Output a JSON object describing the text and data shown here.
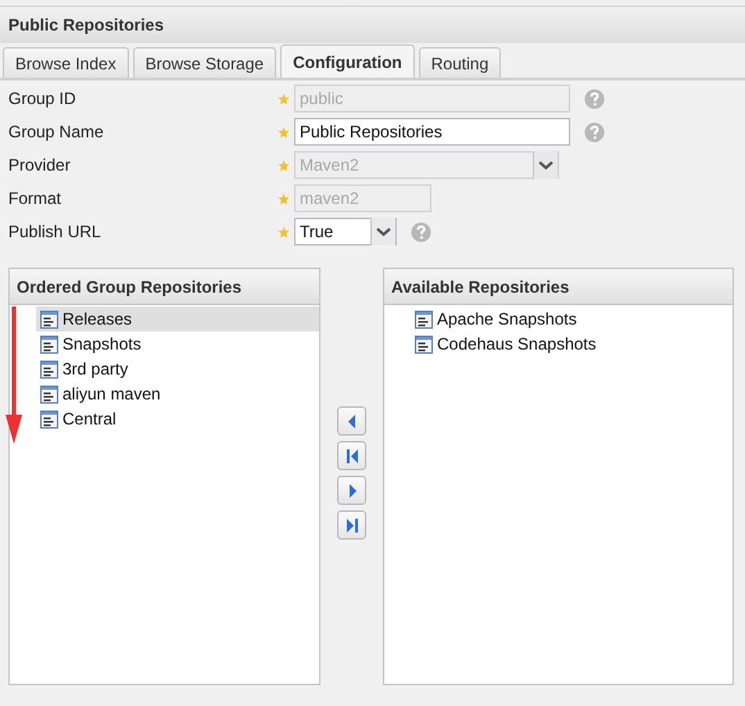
{
  "window": {
    "title": "Public Repositories"
  },
  "tabs": [
    {
      "label": "Browse Index",
      "selected": false
    },
    {
      "label": "Browse Storage",
      "selected": false
    },
    {
      "label": "Configuration",
      "selected": true
    },
    {
      "label": "Routing",
      "selected": false
    }
  ],
  "fields": [
    {
      "label": "Group ID",
      "kind": "text",
      "value": "public",
      "disabled": true,
      "required": true,
      "help": true
    },
    {
      "label": "Group Name",
      "kind": "text",
      "value": "Public Repositories",
      "disabled": false,
      "required": true,
      "help": true
    },
    {
      "label": "Provider",
      "kind": "select",
      "value": "Maven2",
      "disabled": true,
      "required": true,
      "help": false
    },
    {
      "label": "Format",
      "kind": "text",
      "value": "maven2",
      "disabled": true,
      "required": true,
      "help": false
    },
    {
      "label": "Publish URL",
      "kind": "select",
      "value": "True",
      "disabled": false,
      "required": true,
      "help": true
    }
  ],
  "ordered_panel": {
    "title": "Ordered Group Repositories",
    "items": [
      {
        "name": "Releases",
        "selected": true
      },
      {
        "name": "Snapshots",
        "selected": false
      },
      {
        "name": "3rd party",
        "selected": false
      },
      {
        "name": "aliyun maven",
        "selected": false
      },
      {
        "name": "Central",
        "selected": false
      }
    ]
  },
  "available_panel": {
    "title": "Available Repositories",
    "items": [
      {
        "name": "Apache Snapshots",
        "selected": false
      },
      {
        "name": "Codehaus Snapshots",
        "selected": false
      }
    ]
  },
  "move_buttons": [
    {
      "kind": "left"
    },
    {
      "kind": "first"
    },
    {
      "kind": "right"
    },
    {
      "kind": "last"
    }
  ]
}
